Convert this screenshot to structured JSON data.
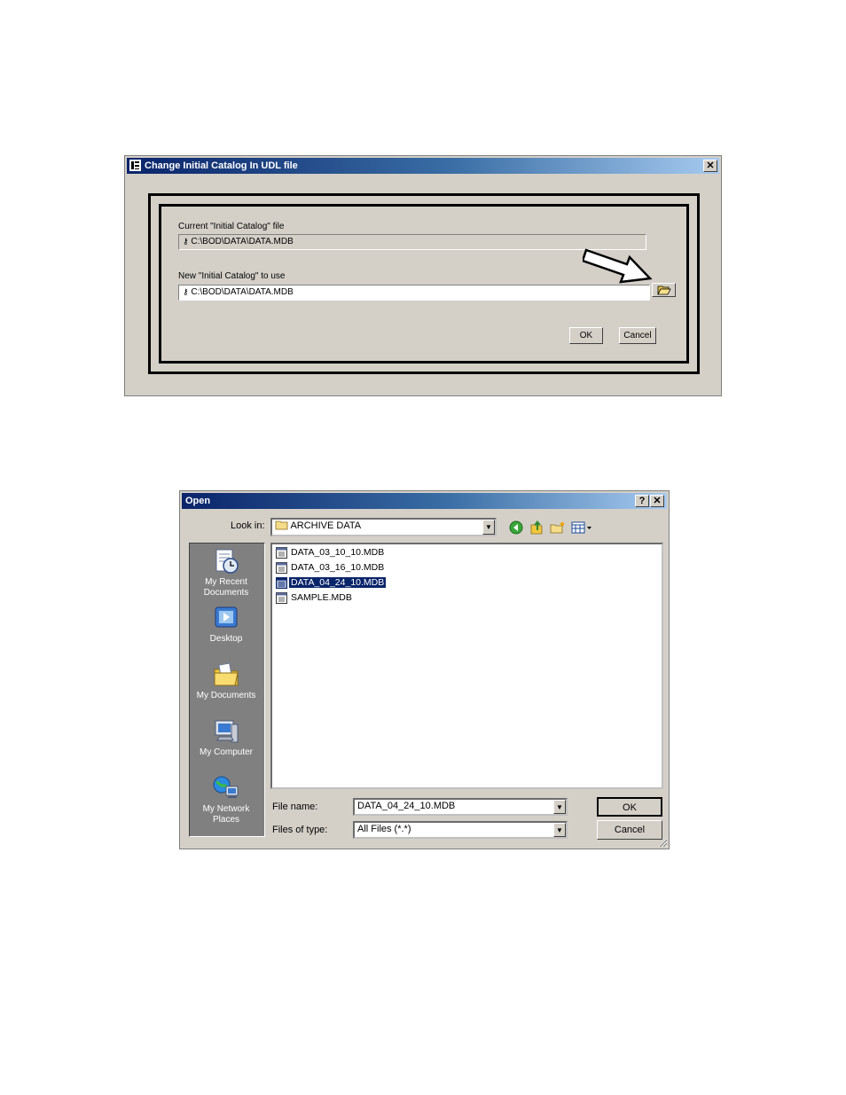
{
  "udl_dialog": {
    "title": "Change Initial Catalog In UDL file",
    "close_label": "✕",
    "current_label": "Current \"Initial Catalog\" file",
    "current_value": "C:\\BOD\\DATA\\DATA.MDB",
    "new_label": "New \"Initial Catalog\" to use",
    "new_value": "C:\\BOD\\DATA\\DATA.MDB",
    "ok_label": "OK",
    "cancel_label": "Cancel"
  },
  "open_dialog": {
    "title": "Open",
    "help_label": "?",
    "close_label": "✕",
    "look_in_label": "Look in:",
    "look_in_value": "ARCHIVE DATA",
    "places": [
      {
        "label": "My Recent Documents"
      },
      {
        "label": "Desktop"
      },
      {
        "label": "My Documents"
      },
      {
        "label": "My Computer"
      },
      {
        "label": "My Network Places"
      }
    ],
    "files": [
      {
        "name": "DATA_03_10_10.MDB",
        "selected": false
      },
      {
        "name": "DATA_03_16_10.MDB",
        "selected": false
      },
      {
        "name": "DATA_04_24_10.MDB",
        "selected": true
      },
      {
        "name": "SAMPLE.MDB",
        "selected": false
      }
    ],
    "file_name_label": "File name:",
    "file_name_value": "DATA_04_24_10.MDB",
    "file_type_label": "Files of type:",
    "file_type_value": "All Files (*.*)",
    "ok_label": "OK",
    "cancel_label": "Cancel"
  },
  "colors": {
    "title_gradient_start": "#0a246a",
    "dialog_face": "#d4d0c8",
    "places_bar": "#808080",
    "selection": "#0a246a"
  }
}
